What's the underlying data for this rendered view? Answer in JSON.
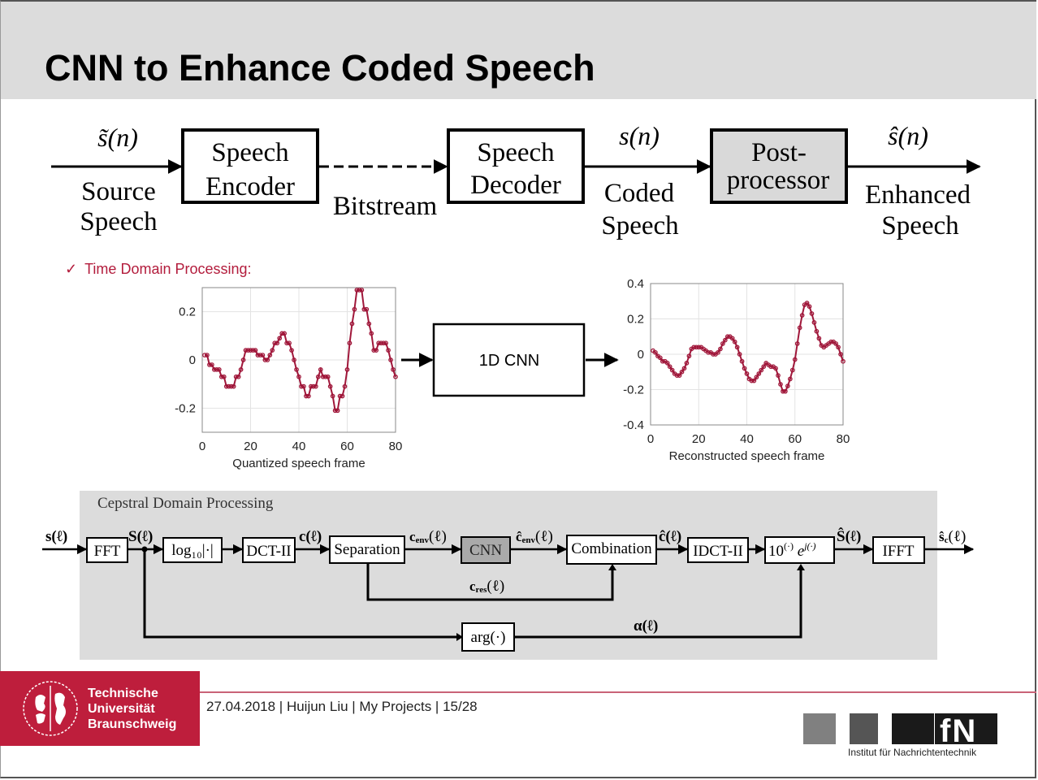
{
  "slide": {
    "title": "CNN to Enhance Coded Speech"
  },
  "top_diagram": {
    "input_signal": "s̃(n)",
    "input_label_line1": "Source",
    "input_label_line2": "Speech",
    "encoder_line1": "Speech",
    "encoder_line2": "Encoder",
    "bitstream_label": "Bitstream",
    "decoder_line1": "Speech",
    "decoder_line2": "Decoder",
    "coded_signal": "s(n)",
    "coded_label_line1": "Coded",
    "coded_label_line2": "Speech",
    "postprocessor_line1": "Post-",
    "postprocessor_line2": "processor",
    "output_signal": "ŝ(n)",
    "output_label_line1": "Enhanced",
    "output_label_line2": "Speech"
  },
  "time_domain": {
    "bullet_icon": "checkmark-icon",
    "bullet_symbol": "✓",
    "heading": "Time Domain Processing:",
    "cnn_label": "1D CNN"
  },
  "chart_data": [
    {
      "type": "line",
      "title": "",
      "xlabel": "Quantized speech frame",
      "ylabel": "",
      "xlim": [
        0,
        80
      ],
      "ylim": [
        -0.3,
        0.3
      ],
      "xticks": [
        "0",
        "20",
        "40",
        "60",
        "80"
      ],
      "yticks": [
        "-0.2",
        "0",
        "0.2"
      ],
      "ytick_values": [
        -0.2,
        0,
        0.2
      ],
      "xtick_values": [
        0,
        20,
        40,
        60,
        80
      ],
      "grid": true,
      "marker": "circle",
      "color": "#a0173a",
      "x": [
        1,
        2,
        3,
        4,
        5,
        6,
        7,
        8,
        9,
        10,
        11,
        12,
        13,
        14,
        15,
        16,
        17,
        18,
        19,
        20,
        21,
        22,
        23,
        24,
        25,
        26,
        27,
        28,
        29,
        30,
        31,
        32,
        33,
        34,
        35,
        36,
        37,
        38,
        39,
        40,
        41,
        42,
        43,
        44,
        45,
        46,
        47,
        48,
        49,
        50,
        51,
        52,
        53,
        54,
        55,
        56,
        57,
        58,
        59,
        60,
        61,
        62,
        63,
        64,
        65,
        66,
        67,
        68,
        69,
        70,
        71,
        72,
        73,
        74,
        75,
        76,
        77,
        78,
        79,
        80
      ],
      "values": [
        0.02,
        0.02,
        -0.02,
        -0.02,
        -0.04,
        -0.04,
        -0.04,
        -0.07,
        -0.07,
        -0.11,
        -0.11,
        -0.11,
        -0.11,
        -0.07,
        -0.07,
        -0.04,
        0.0,
        0.04,
        0.04,
        0.04,
        0.04,
        0.04,
        0.02,
        0.02,
        0.02,
        0.0,
        0.0,
        0.02,
        0.04,
        0.07,
        0.07,
        0.09,
        0.11,
        0.11,
        0.07,
        0.07,
        0.04,
        0.0,
        -0.04,
        -0.07,
        -0.11,
        -0.11,
        -0.15,
        -0.15,
        -0.11,
        -0.11,
        -0.11,
        -0.07,
        -0.04,
        -0.07,
        -0.07,
        -0.07,
        -0.11,
        -0.15,
        -0.21,
        -0.21,
        -0.15,
        -0.15,
        -0.11,
        -0.04,
        0.07,
        0.15,
        0.21,
        0.29,
        0.29,
        0.29,
        0.21,
        0.21,
        0.15,
        0.11,
        0.04,
        0.04,
        0.07,
        0.07,
        0.07,
        0.07,
        0.04,
        0.0,
        -0.04,
        -0.07,
        -0.11
      ]
    },
    {
      "type": "line",
      "title": "",
      "xlabel": "Reconstructed speech frame",
      "ylabel": "",
      "xlim": [
        0,
        80
      ],
      "ylim": [
        -0.4,
        0.4
      ],
      "xticks": [
        "0",
        "20",
        "40",
        "60",
        "80"
      ],
      "yticks": [
        "-0.4",
        "-0.2",
        "0",
        "0.2",
        "0.4"
      ],
      "ytick_values": [
        -0.4,
        -0.2,
        0,
        0.2,
        0.4
      ],
      "xtick_values": [
        0,
        20,
        40,
        60,
        80
      ],
      "grid": true,
      "marker": "circle",
      "color": "#a0173a",
      "x": [
        1,
        2,
        3,
        4,
        5,
        6,
        7,
        8,
        9,
        10,
        11,
        12,
        13,
        14,
        15,
        16,
        17,
        18,
        19,
        20,
        21,
        22,
        23,
        24,
        25,
        26,
        27,
        28,
        29,
        30,
        31,
        32,
        33,
        34,
        35,
        36,
        37,
        38,
        39,
        40,
        41,
        42,
        43,
        44,
        45,
        46,
        47,
        48,
        49,
        50,
        51,
        52,
        53,
        54,
        55,
        56,
        57,
        58,
        59,
        60,
        61,
        62,
        63,
        64,
        65,
        66,
        67,
        68,
        69,
        70,
        71,
        72,
        73,
        74,
        75,
        76,
        77,
        78,
        79,
        80
      ],
      "values": [
        0.02,
        0.01,
        -0.01,
        -0.02,
        -0.04,
        -0.04,
        -0.05,
        -0.07,
        -0.09,
        -0.11,
        -0.12,
        -0.12,
        -0.1,
        -0.08,
        -0.05,
        -0.01,
        0.03,
        0.04,
        0.04,
        0.04,
        0.04,
        0.03,
        0.02,
        0.01,
        0.01,
        0.0,
        0.0,
        0.01,
        0.03,
        0.06,
        0.08,
        0.1,
        0.1,
        0.09,
        0.07,
        0.04,
        0.0,
        -0.04,
        -0.08,
        -0.11,
        -0.14,
        -0.15,
        -0.15,
        -0.13,
        -0.11,
        -0.09,
        -0.07,
        -0.05,
        -0.06,
        -0.07,
        -0.07,
        -0.08,
        -0.12,
        -0.17,
        -0.21,
        -0.21,
        -0.18,
        -0.14,
        -0.09,
        -0.03,
        0.06,
        0.15,
        0.22,
        0.28,
        0.29,
        0.27,
        0.23,
        0.18,
        0.13,
        0.09,
        0.05,
        0.04,
        0.05,
        0.06,
        0.07,
        0.07,
        0.06,
        0.04,
        0.0,
        -0.04,
        -0.08,
        -0.11
      ]
    }
  ],
  "cepstral": {
    "panel_title": "Cepstral Domain Processing",
    "input_signal": "s(ℓ)",
    "fft": "FFT",
    "spectrum": "S(ℓ)",
    "log": "log₁₀|·|",
    "dct": "DCT-II",
    "cepstrum": "c(ℓ)",
    "separation": "Separation",
    "c_env": "c_env(ℓ)",
    "c_env_base": "c",
    "c_env_sub": "env",
    "cnn": "CNN",
    "c_env_hat_base": "ĉ",
    "c_env_hat_sub": "env",
    "combination": "Combination",
    "c_hat": "ĉ(ℓ)",
    "idct": "IDCT-II",
    "exp_block": "10^(·) e^j(·)",
    "S_hat": "Ŝ(ℓ)",
    "ifft": "IFFT",
    "output_base": "ŝ",
    "output_sub": "c",
    "c_res_base": "c",
    "c_res_sub": "res",
    "arg": "arg(·)",
    "alpha": "α(ℓ)",
    "ell": "(ℓ)"
  },
  "footer": {
    "university_line1": "Technische",
    "university_line2": "Universität",
    "university_line3": "Braunschweig",
    "info": "27.04.2018 | Huijun Liu | My Projects | 15/28",
    "institute": "Institut für Nachrichtentechnik",
    "ifn_mark": "fN",
    "colors": {
      "brand_red": "#be1e3c",
      "plot_red": "#a0173a",
      "header_gray": "#dcdcdc"
    }
  }
}
